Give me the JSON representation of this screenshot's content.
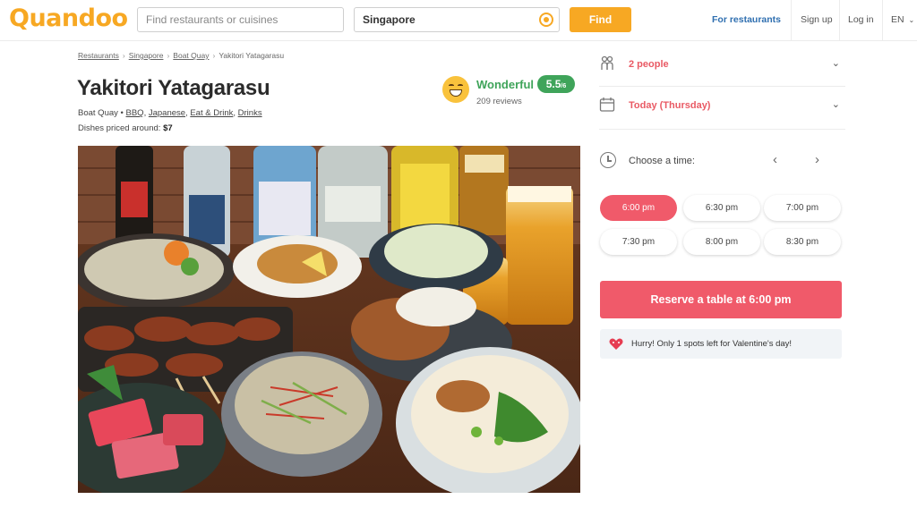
{
  "header": {
    "logo": "Quandoo",
    "search_placeholder": "Find restaurants or cuisines",
    "location_value": "Singapore",
    "find_label": "Find",
    "nav": {
      "for_restaurants": "For restaurants",
      "sign_up": "Sign up",
      "log_in": "Log in",
      "language": "EN"
    }
  },
  "breadcrumb": [
    "Restaurants",
    "Singapore",
    "Boat Quay",
    "Yakitori Yatagarasu"
  ],
  "restaurant": {
    "name": "Yakitori Yatagarasu",
    "area": "Boat Quay",
    "tags": [
      "BBQ",
      "Japanese",
      "Eat & Drink",
      "Drinks"
    ],
    "price_label": "Dishes priced around:",
    "price_value": "$7",
    "rating_word": "Wonderful",
    "rating_score": "5.5",
    "rating_max": "/6",
    "reviews": "209 reviews"
  },
  "booking": {
    "people": "2 people",
    "date": "Today (Thursday)",
    "choose_time": "Choose a time:",
    "slots": [
      "6:00 pm",
      "6:30 pm",
      "7:00 pm",
      "7:30 pm",
      "8:00 pm",
      "8:30 pm"
    ],
    "reserve_label": "Reserve a table at 6:00 pm",
    "hurry_text": "Hurry! Only 1 spots left for Valentine's day!"
  },
  "colors": {
    "brand": "#f7a823",
    "accent": "#f05a6a",
    "rating": "#3fa45a",
    "link": "#2f6fb0"
  }
}
